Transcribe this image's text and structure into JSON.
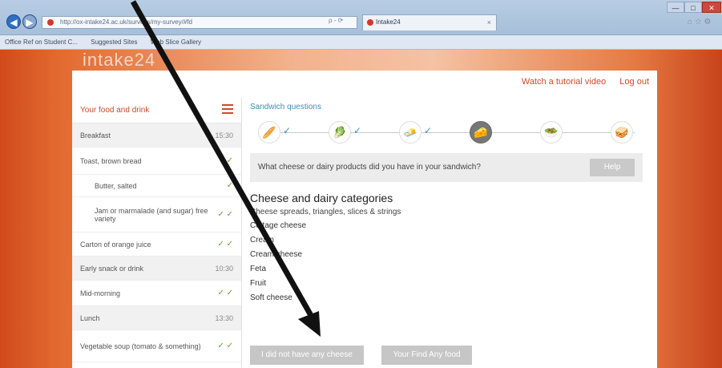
{
  "browser": {
    "address": "http://ox-intake24.ac.uk/surveys/my-survey/#fd",
    "tab_title": "Intake24",
    "tab_close": "×",
    "address_tools": "ρ - ⟳",
    "win_min": "—",
    "win_max": "□",
    "win_close": "✕",
    "home_icons": "⌂ ☆ ⚙",
    "favorites": [
      "Office Ref on Student C...",
      "Suggested Sites",
      "Web Slice Gallery"
    ]
  },
  "brand": "intake24",
  "topbar": {
    "watch_video": "Watch a tutorial video",
    "logout": "Log out"
  },
  "sidebar": {
    "header": "Your food and drink",
    "rows": [
      {
        "label": "Breakfast",
        "status": "15:30",
        "alt": true,
        "indent": false,
        "grey": true
      },
      {
        "label": "Toast, brown bread",
        "status": "✓",
        "alt": false,
        "indent": false,
        "grey": false
      },
      {
        "label": "Butter, salted",
        "status": "✓",
        "alt": false,
        "indent": true,
        "grey": false
      },
      {
        "label": "Jam or marmalade (and sugar) free variety",
        "status": "✓ ✓",
        "alt": false,
        "indent": true,
        "grey": false
      },
      {
        "label": "Carton of orange juice",
        "status": "✓ ✓",
        "alt": false,
        "indent": false,
        "grey": false
      },
      {
        "label": "Early snack or drink",
        "status": "10:30",
        "alt": true,
        "indent": false,
        "grey": true
      },
      {
        "label": "Mid-morning",
        "status": "✓ ✓",
        "alt": false,
        "indent": false,
        "grey": false
      },
      {
        "label": "Lunch",
        "status": "13:30",
        "alt": true,
        "indent": false,
        "grey": true
      },
      {
        "label": "Vegetable soup (tomato & something)",
        "status": "✓ ✓",
        "alt": false,
        "indent": false,
        "grey": false
      }
    ]
  },
  "main": {
    "progress_title": "Sandwich questions",
    "steps": [
      {
        "icon": "🥖",
        "done": true,
        "active": false
      },
      {
        "icon": "🥬",
        "done": true,
        "active": false
      },
      {
        "icon": "🧈",
        "done": true,
        "active": false
      },
      {
        "icon": "🧀",
        "done": false,
        "active": true
      },
      {
        "icon": "🥗",
        "done": false,
        "active": false
      },
      {
        "icon": "🥪",
        "done": false,
        "active": false
      }
    ],
    "check": "✓",
    "question": "What cheese or dairy products did you have in your sandwich?",
    "help_label": "Help",
    "category_title": "Cheese and dairy categories",
    "category_subtitle": "Cheese spreads, triangles, slices & strings",
    "categories": [
      "Cottage cheese",
      "Cream",
      "Cream cheese",
      "Feta",
      "Fruit",
      "Soft cheese"
    ],
    "no_cheese_label": "I did not have any cheese",
    "browse_label": "Your Find Any food"
  }
}
